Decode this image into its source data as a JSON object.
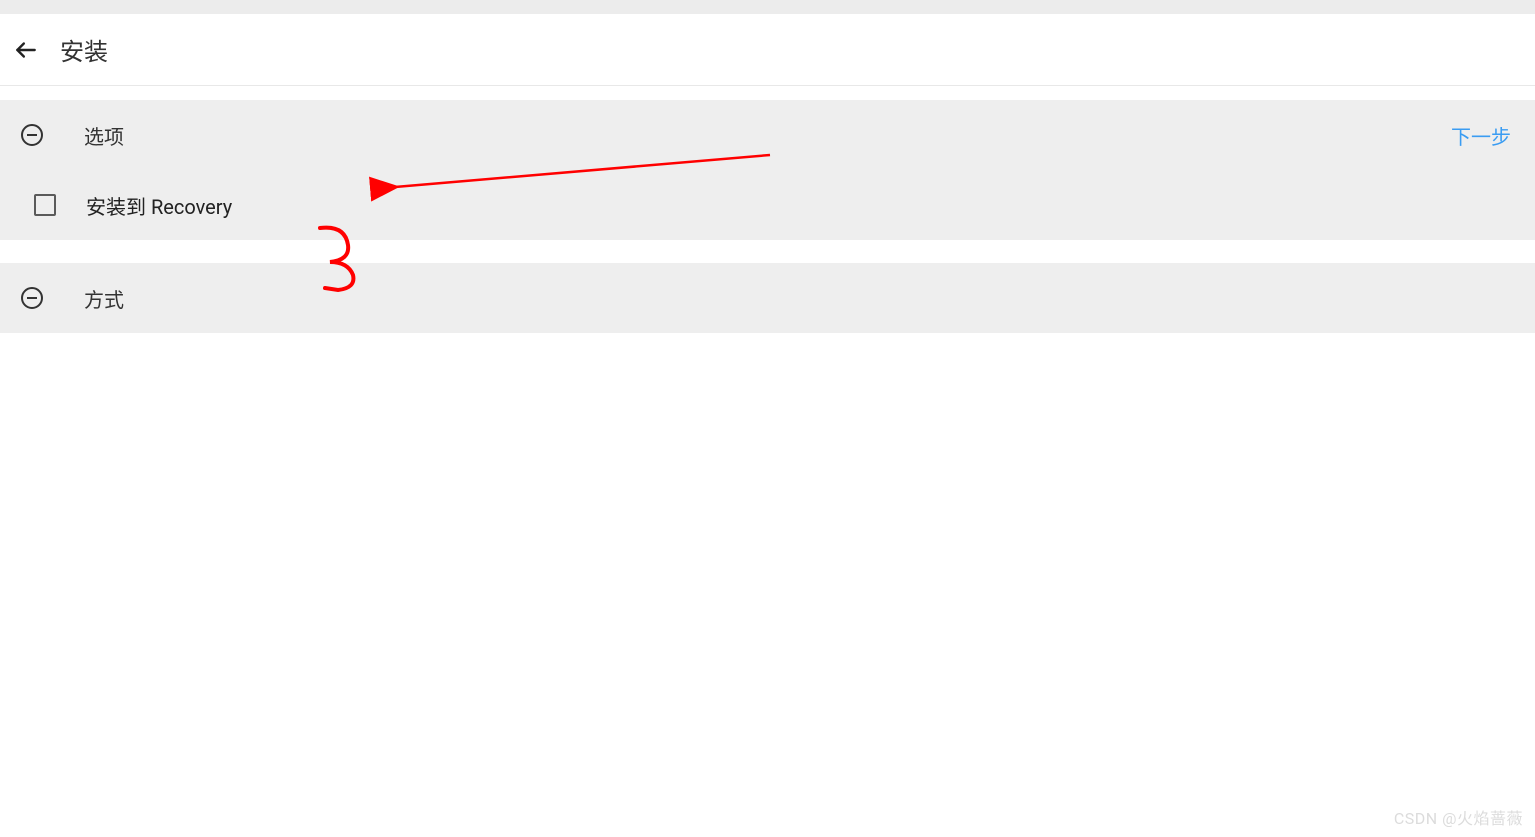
{
  "header": {
    "title": "安装"
  },
  "sections": {
    "options": {
      "title": "选项",
      "next_label": "下一步",
      "items": [
        {
          "label": "安装到 Recovery",
          "checked": false
        }
      ]
    },
    "method": {
      "title": "方式"
    }
  },
  "annotation": {
    "number": "3"
  },
  "watermark": "CSDN @火焰蔷薇"
}
